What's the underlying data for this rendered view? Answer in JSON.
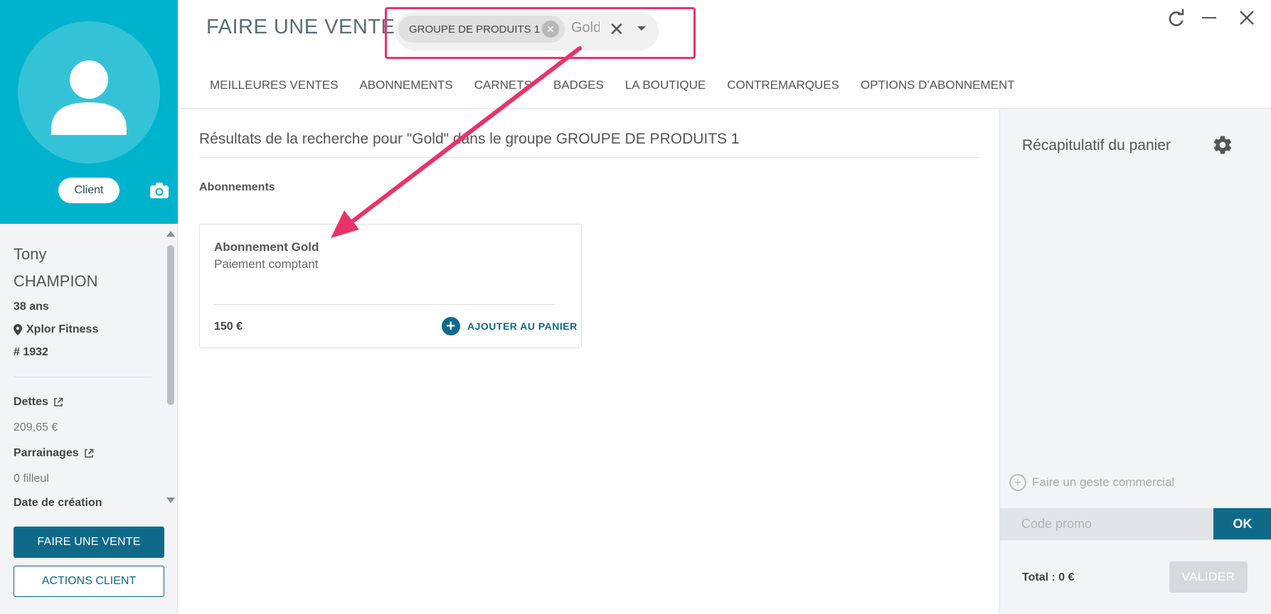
{
  "sidebar": {
    "client_badge": "Client",
    "first_name": "Tony",
    "last_name": "CHAMPION",
    "age": "38 ans",
    "club": "Xplor Fitness",
    "member_id": "# 1932",
    "debts_label": "Dettes",
    "debts_value": "209,65 €",
    "referrals_label": "Parrainages",
    "referrals_value": "0 filleul",
    "created_label": "Date de création",
    "sale_button": "FAIRE UNE VENTE",
    "actions_button": "ACTIONS CLIENT"
  },
  "header": {
    "title": "FAIRE UNE VENTE",
    "search_chip": "GROUPE DE PRODUITS 1",
    "search_text": "Gold"
  },
  "tabs": [
    {
      "label": "MEILLEURES VENTES"
    },
    {
      "label": "ABONNEMENTS"
    },
    {
      "label": "CARNETS"
    },
    {
      "label": "BADGES"
    },
    {
      "label": "LA BOUTIQUE"
    },
    {
      "label": "CONTREMARQUES"
    },
    {
      "label": "OPTIONS D'ABONNEMENT"
    }
  ],
  "results": {
    "title": "Résultats de la recherche pour \"Gold\" dans le groupe GROUPE DE PRODUITS 1",
    "section_label": "Abonnements",
    "card": {
      "title": "Abonnement Gold",
      "subtitle": "Paiement comptant",
      "price": "150 €",
      "add_label": "AJOUTER AU PANIER"
    }
  },
  "cart": {
    "title": "Récapitulatif du panier",
    "geste_label": "Faire un geste commercial",
    "promo_placeholder": "Code promo",
    "promo_ok": "OK",
    "total": "Total : 0 €",
    "validate": "VALIDER"
  },
  "colors": {
    "brand_cyan": "#00b3cc",
    "primary_dark": "#0f6a8a",
    "annotation_pink": "#e8336a"
  },
  "icons": [
    "user-avatar-icon",
    "camera-icon",
    "location-pin-icon",
    "external-link-icon",
    "refresh-icon",
    "minimize-icon",
    "close-icon",
    "chip-remove-icon",
    "clear-icon",
    "chevron-down-icon",
    "plus-circle-icon",
    "gear-icon"
  ]
}
